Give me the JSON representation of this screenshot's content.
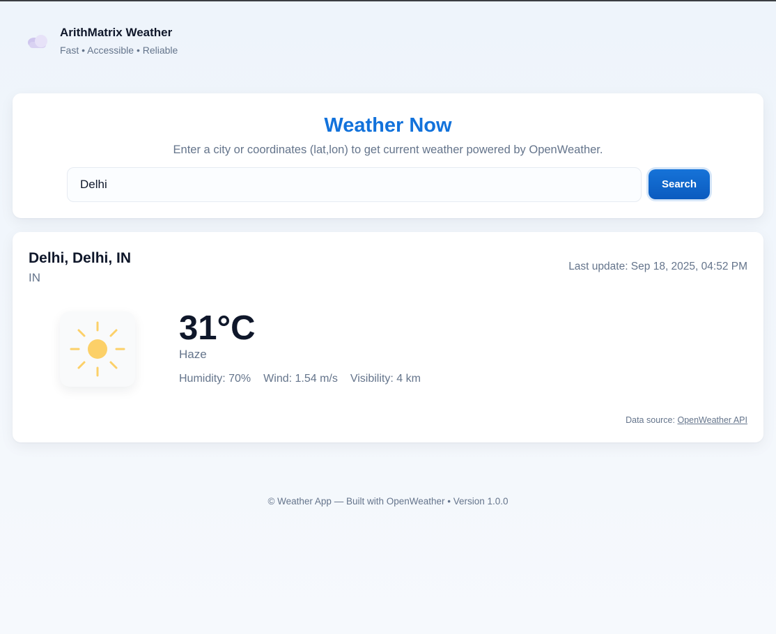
{
  "brand": {
    "title": "ArithMatrix Weather",
    "tagline": "Fast • Accessible • Reliable",
    "logo_icon": "cloud-icon"
  },
  "search": {
    "title": "Weather Now",
    "description": "Enter a city or coordinates (lat,lon) to get current weather powered by OpenWeather.",
    "input_value": "Delhi",
    "button_label": "Search"
  },
  "result": {
    "location": "Delhi, Delhi, IN",
    "country": "IN",
    "last_update": "Last update: Sep 18, 2025, 04:52 PM",
    "weather_icon": "sun-icon",
    "temperature": "31°C",
    "condition": "Haze",
    "humidity": "Humidity: 70%",
    "wind": "Wind: 1.54 m/s",
    "visibility": "Visibility: 4 km",
    "data_source_prefix": "Data source:",
    "data_source_link": "OpenWeather API"
  },
  "footer": {
    "text": "© Weather App — Built with OpenWeather • Version 1.0.0"
  },
  "colors": {
    "accent": "#1272db",
    "button": "#0b5bbf",
    "sun": "#fcd068",
    "muted_text": "#64748b",
    "heading_text": "#0f172a"
  }
}
